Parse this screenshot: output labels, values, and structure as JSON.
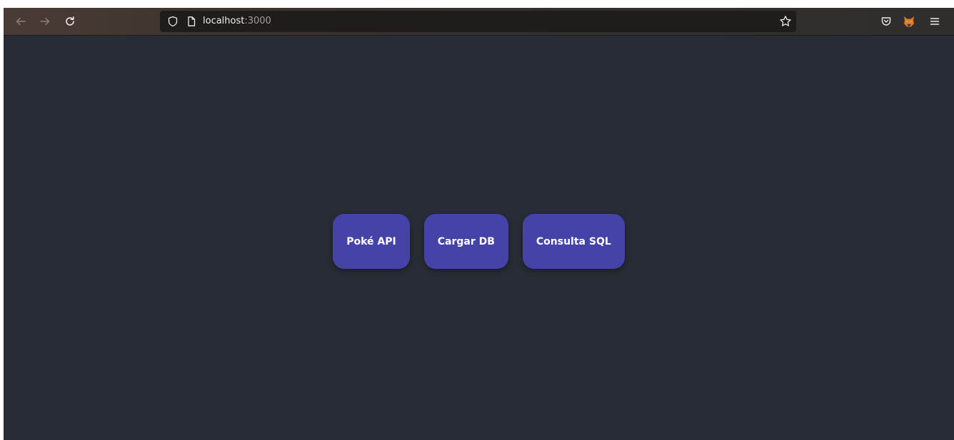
{
  "browser": {
    "url_host": "localhost",
    "url_port": ":3000",
    "icons": {
      "back": "arrow-left-icon",
      "forward": "arrow-right-icon",
      "reload": "reload-icon",
      "tracking_protection": "shield-icon",
      "page_info": "page-icon",
      "bookmark": "star-icon",
      "pocket": "pocket-icon",
      "extension": "fox-extension-icon",
      "menu": "hamburger-menu-icon"
    }
  },
  "main": {
    "buttons": [
      {
        "label": "Poké API"
      },
      {
        "label": "Cargar DB"
      },
      {
        "label": "Consulta SQL"
      }
    ]
  },
  "colors": {
    "page_background": "#282c34",
    "button_background": "#4542a8",
    "button_text": "#ffffff"
  }
}
